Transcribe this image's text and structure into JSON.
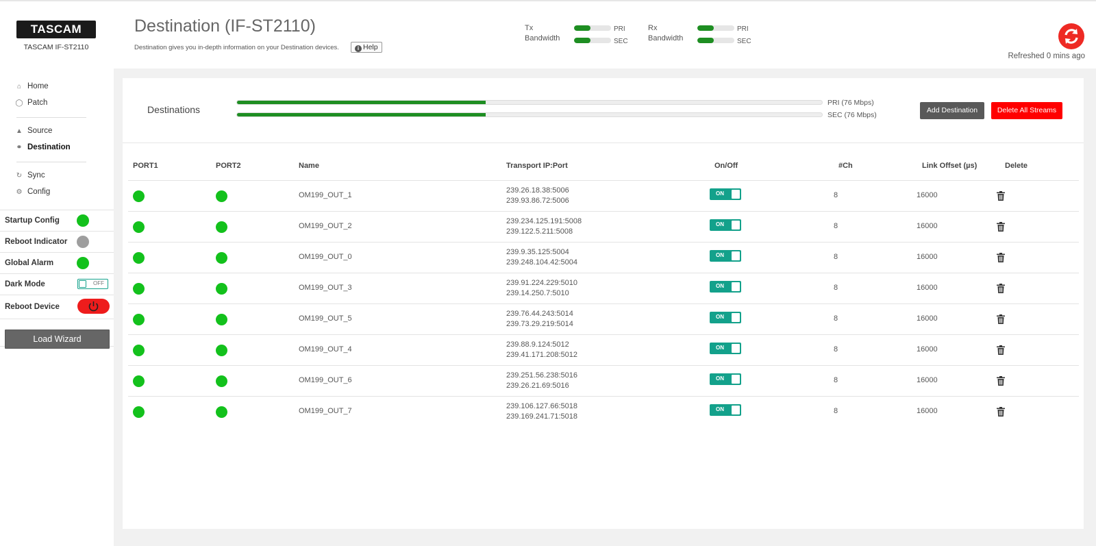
{
  "header": {
    "logo": "TASCAM",
    "device": "TASCAM IF-ST2110",
    "title": "Destination (IF-ST2110)",
    "description": "Destination gives you in-depth information on your Destination devices.",
    "help_label": "Help",
    "tx_label_1": "Tx",
    "tx_label_2": "Bandwidth",
    "rx_label_1": "Rx",
    "rx_label_2": "Bandwidth",
    "pri_tag": "PRI",
    "sec_tag": "SEC",
    "tx_pri_level": 0.45,
    "tx_sec_level": 0.45,
    "rx_pri_level": 0.45,
    "rx_sec_level": 0.45,
    "refreshed": "Refreshed 0 mins ago"
  },
  "sidebar": {
    "nav": [
      {
        "label": "Home",
        "icon": "home-icon"
      },
      {
        "label": "Patch",
        "icon": "patch-icon"
      },
      {
        "label": "Source",
        "icon": "speaker-icon"
      },
      {
        "label": "Destination",
        "icon": "headphones-icon"
      },
      {
        "label": "Sync",
        "icon": "sync-icon"
      },
      {
        "label": "Config",
        "icon": "gears-icon"
      }
    ],
    "startup_config": "Startup Config",
    "reboot_indicator": "Reboot Indicator",
    "global_alarm": "Global Alarm",
    "dark_mode": "Dark Mode",
    "dark_mode_value": "OFF",
    "reboot_device": "Reboot Device",
    "load_wizard": "Load Wizard",
    "colors": {
      "ok": "#13c11c",
      "idle": "#9e9e9e",
      "danger": "#ee1c1c"
    }
  },
  "destinations": {
    "title": "Destinations",
    "pri_label": "PRI (76 Mbps)",
    "sec_label": "SEC (76 Mbps)",
    "pri_level": 0.425,
    "sec_level": 0.425,
    "add_label": "Add Destination",
    "delete_all_label": "Delete All Streams"
  },
  "table": {
    "headers": {
      "port1": "PORT1",
      "port2": "PORT2",
      "name": "Name",
      "transport": "Transport IP:Port",
      "onoff": "On/Off",
      "ch": "#Ch",
      "offset": "Link Offset (µs)",
      "delete": "Delete"
    },
    "on_label": "ON",
    "rows": [
      {
        "name": "OM199_OUT_1",
        "ip1": "239.26.18.38:5006",
        "ip2": "239.93.86.72:5006",
        "ch": "8",
        "offset": "16000"
      },
      {
        "name": "OM199_OUT_2",
        "ip1": "239.234.125.191:5008",
        "ip2": "239.122.5.211:5008",
        "ch": "8",
        "offset": "16000"
      },
      {
        "name": "OM199_OUT_0",
        "ip1": "239.9.35.125:5004",
        "ip2": "239.248.104.42:5004",
        "ch": "8",
        "offset": "16000"
      },
      {
        "name": "OM199_OUT_3",
        "ip1": "239.91.224.229:5010",
        "ip2": "239.14.250.7:5010",
        "ch": "8",
        "offset": "16000"
      },
      {
        "name": "OM199_OUT_5",
        "ip1": "239.76.44.243:5014",
        "ip2": "239.73.29.219:5014",
        "ch": "8",
        "offset": "16000"
      },
      {
        "name": "OM199_OUT_4",
        "ip1": "239.88.9.124:5012",
        "ip2": "239.41.171.208:5012",
        "ch": "8",
        "offset": "16000"
      },
      {
        "name": "OM199_OUT_6",
        "ip1": "239.251.56.238:5016",
        "ip2": "239.26.21.69:5016",
        "ch": "8",
        "offset": "16000"
      },
      {
        "name": "OM199_OUT_7",
        "ip1": "239.106.127.66:5018",
        "ip2": "239.169.241.71:5018",
        "ch": "8",
        "offset": "16000"
      }
    ]
  }
}
